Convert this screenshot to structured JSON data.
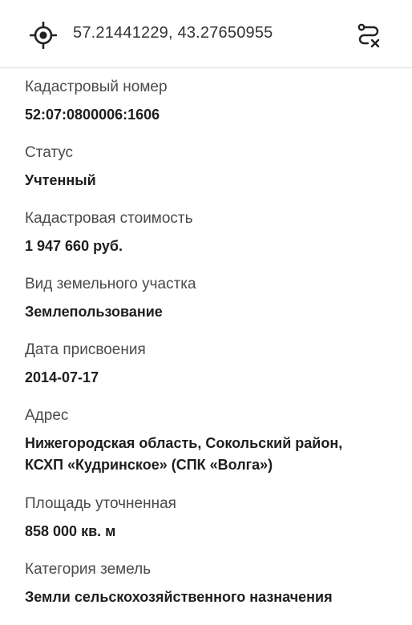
{
  "header": {
    "coordinates": "57.21441229, 43.27650955",
    "locate_icon": "crosshair-target-icon",
    "route_icon": "route-clear-icon"
  },
  "fields": [
    {
      "label": "Кадастровый номер",
      "value": "52:07:0800006:1606"
    },
    {
      "label": "Статус",
      "value": "Учтенный"
    },
    {
      "label": "Кадастровая стоимость",
      "value": "1 947 660 руб."
    },
    {
      "label": "Вид земельного участка",
      "value": "Землепользование"
    },
    {
      "label": "Дата присвоения",
      "value": "2014-07-17"
    },
    {
      "label": "Адрес",
      "value_lines": [
        "Нижегородская область, Сокольский район,",
        "КСХП «Кудринское» (СПК «Волга»)"
      ]
    },
    {
      "label": "Площадь уточненная",
      "value": "858 000 кв. м"
    },
    {
      "label": "Категория земель",
      "value": "Земли сельскохозяйственного назначения"
    }
  ],
  "colors": {
    "text_primary": "#1e1e1e",
    "text_secondary": "#4a4a4a",
    "background": "#ffffff",
    "divider": "#e4e4e4"
  }
}
